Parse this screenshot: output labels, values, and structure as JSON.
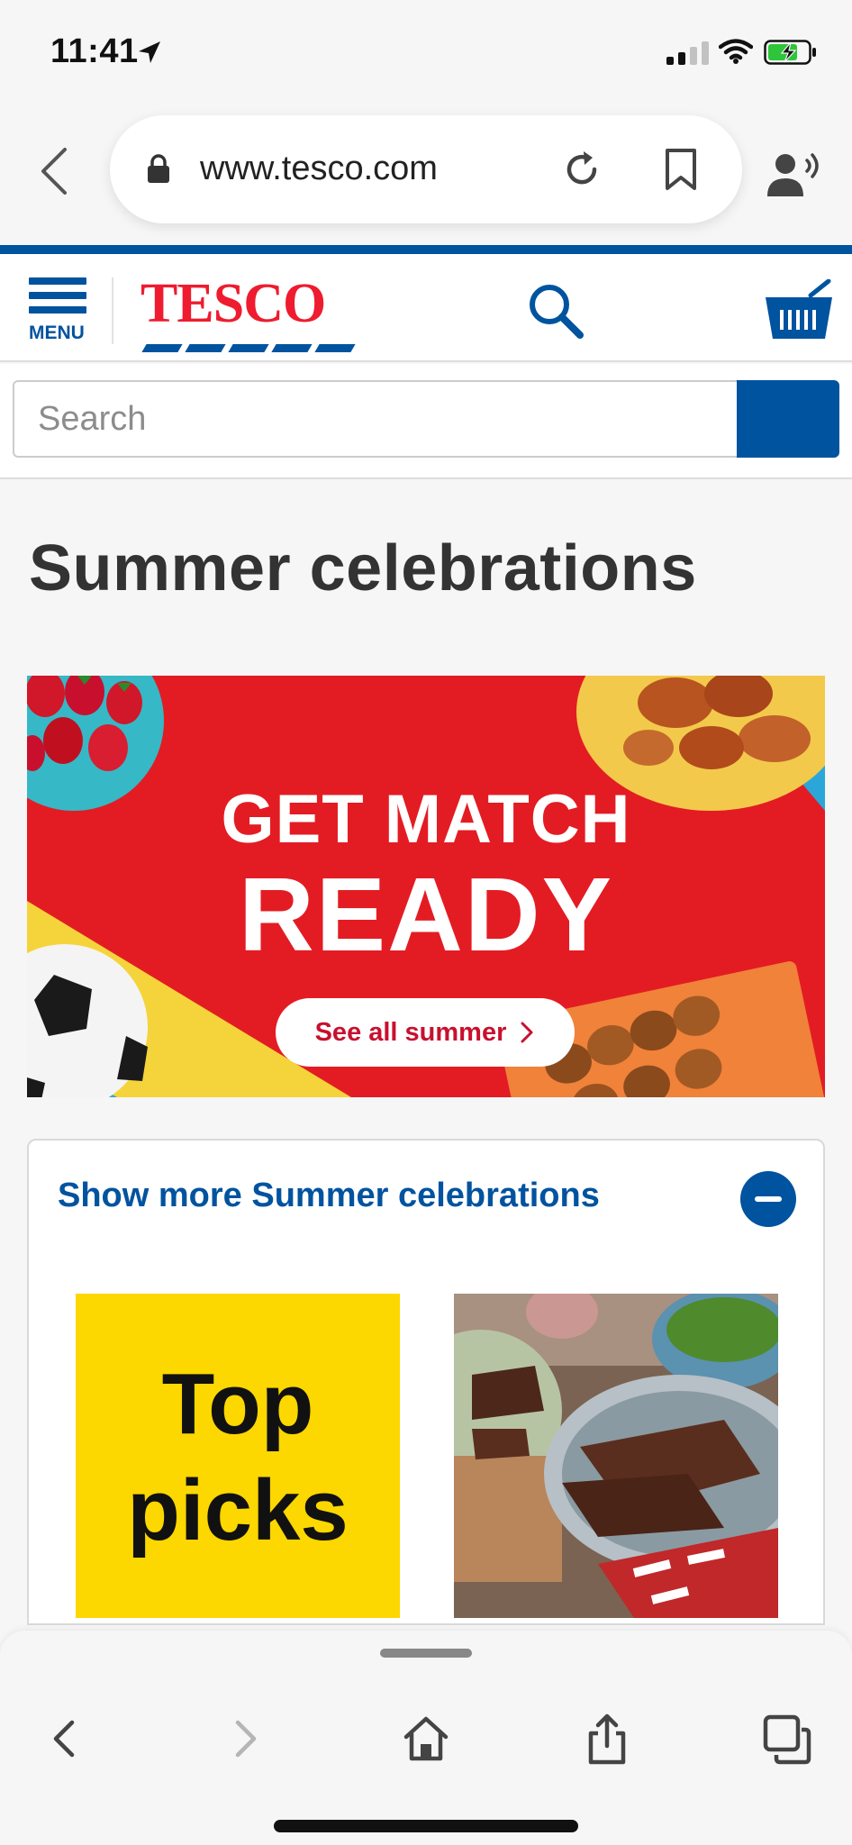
{
  "status_bar": {
    "time": "11:41",
    "location_icon": "location-arrow-icon",
    "signal_icon": "cellular-signal-icon",
    "wifi_icon": "wifi-icon",
    "battery_icon": "battery-charging-icon",
    "battery_level": 0.7
  },
  "browser": {
    "url": "www.tesco.com",
    "icons": {
      "back": "chevron-left-icon",
      "lock": "lock-icon",
      "reload": "reload-icon",
      "bookmark": "bookmark-icon",
      "reader": "speaker-icon"
    }
  },
  "header": {
    "menu_label": "MENU",
    "logo_text": "TESCO",
    "search_icon": "search-icon",
    "basket_icon": "basket-icon"
  },
  "search": {
    "placeholder": "Search",
    "value": ""
  },
  "main": {
    "title": "Summer celebrations",
    "banner": {
      "line1": "GET MATCH",
      "line2": "READY",
      "cta_label": "See all summer"
    },
    "more_section": {
      "label": "Show more Summer celebrations",
      "tiles": [
        {
          "label": "Top picks"
        },
        {
          "label": ""
        }
      ]
    }
  },
  "bottom_toolbar": {
    "icons": [
      "back-icon",
      "forward-icon",
      "home-icon",
      "share-icon",
      "tabs-icon"
    ]
  },
  "colors": {
    "tesco_blue": "#00539f",
    "tesco_red": "#ee1c2e",
    "banner_red": "#e31c23",
    "tile_yellow": "#fcd700",
    "page_bg": "#f6f6f6"
  }
}
